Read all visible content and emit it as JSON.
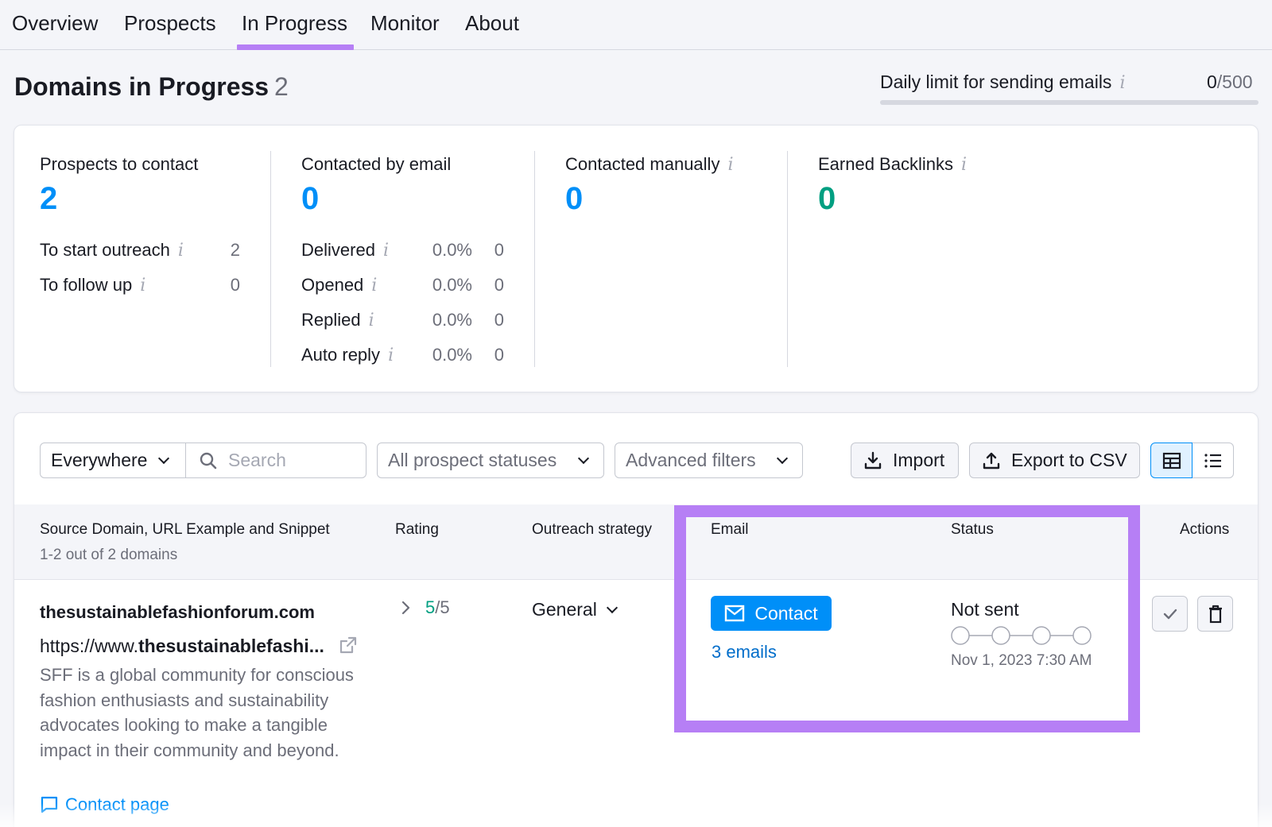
{
  "nav": {
    "tabs": [
      {
        "label": "Overview"
      },
      {
        "label": "Prospects"
      },
      {
        "label": "In Progress"
      },
      {
        "label": "Monitor"
      },
      {
        "label": "About"
      }
    ],
    "active_tab": "In Progress"
  },
  "header": {
    "title": "Domains in Progress",
    "count": "2",
    "daily_limit_label": "Daily limit for sending emails",
    "daily_limit_used": "0",
    "daily_limit_total": "/500",
    "daily_limit_progress": 0
  },
  "stats": {
    "prospects": {
      "title": "Prospects to contact",
      "value": "2",
      "rows": [
        {
          "label": "To start outreach",
          "value": "2"
        },
        {
          "label": "To follow up",
          "value": "0"
        }
      ]
    },
    "email": {
      "title": "Contacted by email",
      "value": "0",
      "rows": [
        {
          "label": "Delivered",
          "pct": "0.0%",
          "value": "0"
        },
        {
          "label": "Opened",
          "pct": "0.0%",
          "value": "0"
        },
        {
          "label": "Replied",
          "pct": "0.0%",
          "value": "0"
        },
        {
          "label": "Auto reply",
          "pct": "0.0%",
          "value": "0"
        }
      ]
    },
    "manual": {
      "title": "Contacted manually",
      "value": "0"
    },
    "backlinks": {
      "title": "Earned Backlinks",
      "value": "0"
    }
  },
  "filters": {
    "scope": "Everywhere",
    "search_placeholder": "Search",
    "status_filter": "All prospect statuses",
    "advanced": "Advanced filters",
    "import_label": "Import",
    "export_label": "Export to CSV"
  },
  "table": {
    "columns": {
      "source": "Source Domain, URL Example and Snippet",
      "source_sub": "1-2 out of 2 domains",
      "rating": "Rating",
      "strategy": "Outreach strategy",
      "email": "Email",
      "status": "Status",
      "actions": "Actions"
    },
    "rows": [
      {
        "domain": "thesustainablefashionforum.com",
        "url_prefix": "https://www.",
        "url_bold": "thesustainablefashi...",
        "snippet": "SFF is a global community for conscious fashion enthusiasts and sustainability advocates looking to make a tangible impact in their community and beyond.",
        "contact_page": "Contact page",
        "rating_value": "5",
        "rating_max": "/5",
        "strategy": "General",
        "contact_button": "Contact",
        "emails_link": "3 emails",
        "status": "Not sent",
        "status_date": "Nov 1, 2023 7:30 AM"
      }
    ]
  },
  "colors": {
    "accent_blue": "#008ff8",
    "highlight_purple": "#b67ff5",
    "success_green": "#009f81"
  }
}
